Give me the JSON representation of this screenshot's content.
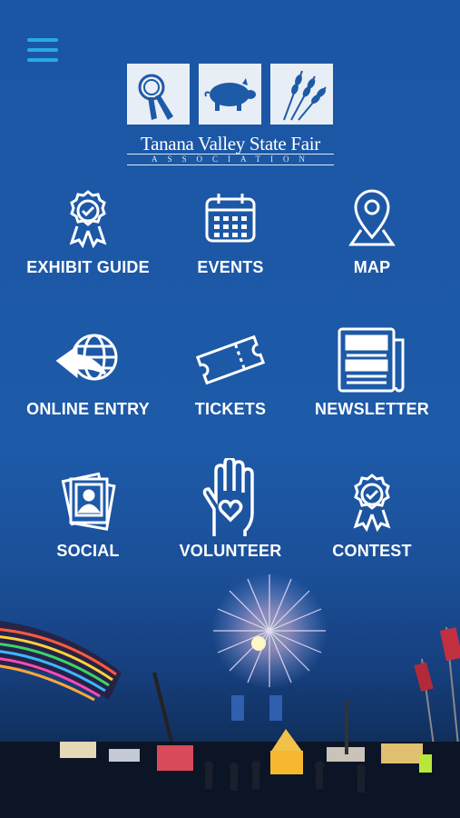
{
  "app": {
    "logo_title": "Tanana Valley State Fair",
    "logo_subtitle": "ASSOCIATION"
  },
  "colors": {
    "background": "#1d5aa8",
    "menu_icon": "#29a9e6",
    "label": "#ffffff"
  },
  "menu": {
    "icon": "hamburger-menu-icon"
  },
  "tiles": [
    {
      "label": "EXHIBIT GUIDE",
      "icon": "award-ribbon-icon"
    },
    {
      "label": "EVENTS",
      "icon": "calendar-icon"
    },
    {
      "label": "MAP",
      "icon": "map-pin-icon"
    },
    {
      "label": "ONLINE ENTRY",
      "icon": "globe-arrow-icon"
    },
    {
      "label": "TICKETS",
      "icon": "ticket-icon"
    },
    {
      "label": "NEWSLETTER",
      "icon": "newspaper-icon"
    },
    {
      "label": "SOCIAL",
      "icon": "photo-cards-icon"
    },
    {
      "label": "VOLUNTEER",
      "icon": "hand-heart-icon"
    },
    {
      "label": "CONTEST",
      "icon": "award-badge-icon"
    }
  ]
}
